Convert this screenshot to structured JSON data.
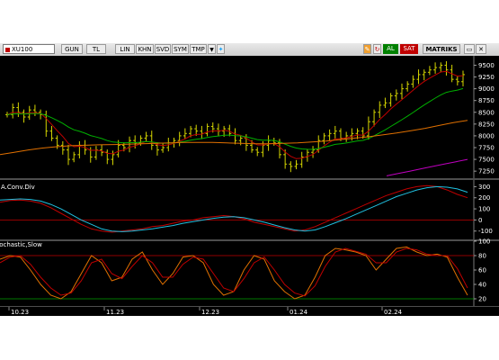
{
  "toolbar": {
    "symbol": "XU100",
    "buttons": [
      "GUN",
      "TL",
      "LIN",
      "KHN",
      "SVD",
      "SYM",
      "TMP"
    ],
    "al_label": "AL",
    "sat_label": "SAT",
    "matriks_label": "MATRIKS",
    "colors": {
      "al": "#008000",
      "sat": "#c00000"
    }
  },
  "chart_data": [
    {
      "type": "candlestick",
      "panel": "price",
      "title": "",
      "ylim": [
        7100,
        9700
      ],
      "yticks": [
        7250,
        7500,
        7750,
        8000,
        8250,
        8500,
        8750,
        9000,
        9250,
        9500
      ],
      "series": [
        {
          "name": "",
          "color": "#d4d400",
          "ohlc_close": [
            8450,
            8600,
            8500,
            8400,
            8550,
            8500,
            8450,
            8100,
            7950,
            7800,
            7700,
            7500,
            7600,
            7800,
            7700,
            7550,
            7700,
            7650,
            7500,
            7600,
            7800,
            7750,
            7900,
            7850,
            7950,
            8000,
            7800,
            7700,
            7750,
            7850,
            7900,
            8000,
            8050,
            8150,
            8100,
            8050,
            8200,
            8150,
            8100,
            8150,
            8050,
            7900,
            7950,
            7800,
            7700,
            7650,
            7800,
            7900,
            7850,
            7600,
            7400,
            7350,
            7400,
            7550,
            7650,
            7700,
            7900,
            8000,
            8050,
            8100,
            7950,
            8000,
            8050,
            8100,
            8000,
            8300,
            8500,
            8650,
            8700,
            8850,
            8900,
            9000,
            9100,
            9200,
            9300,
            9350,
            9400,
            9450,
            9500,
            9400,
            9200,
            9150,
            9300
          ]
        },
        {
          "name": "",
          "color": "#c00000",
          "values_ref": "price_ma_fast"
        },
        {
          "name": "",
          "color": "#00b000",
          "values_ref": "price_ma_mid"
        },
        {
          "name": "",
          "color": "#e07000",
          "values_ref": "price_ma_slow"
        },
        {
          "name": "",
          "color": "#c000c0",
          "values_ref": "price_ma_long"
        }
      ],
      "price_ma_slow": [
        7600,
        7650,
        7700,
        7740,
        7770,
        7790,
        7800,
        7810,
        7815,
        7820,
        7830,
        7840,
        7850,
        7860,
        7860,
        7860,
        7850,
        7840,
        7830,
        7830,
        7840,
        7850,
        7870,
        7890,
        7920,
        7950,
        7980,
        8020,
        8060,
        8110,
        8160,
        8220,
        8280,
        8330
      ],
      "price_ma_long": [
        7150,
        7200,
        7250,
        7300,
        7350,
        7400,
        7450,
        7500
      ]
    },
    {
      "type": "line",
      "panel": "macd",
      "title": "A.Conv.Div",
      "ylim": [
        -175,
        360
      ],
      "yticks": [
        -100,
        0,
        100,
        200,
        300
      ],
      "series": [
        {
          "name": "",
          "color": "#c00000",
          "values": [
            160,
            175,
            180,
            170,
            150,
            110,
            60,
            10,
            -40,
            -80,
            -100,
            -110,
            -100,
            -90,
            -80,
            -60,
            -50,
            -30,
            -10,
            0,
            20,
            30,
            40,
            30,
            10,
            -20,
            -40,
            -60,
            -80,
            -100,
            -90,
            -60,
            -20,
            20,
            60,
            100,
            140,
            180,
            220,
            250,
            280,
            300,
            310,
            300,
            270,
            230,
            200
          ]
        },
        {
          "name": "",
          "color": "#20c0e0",
          "values": [
            180,
            185,
            190,
            185,
            170,
            140,
            100,
            50,
            0,
            -40,
            -80,
            -100,
            -105,
            -100,
            -90,
            -80,
            -65,
            -50,
            -30,
            -15,
            0,
            15,
            25,
            30,
            20,
            0,
            -20,
            -45,
            -70,
            -90,
            -100,
            -90,
            -60,
            -25,
            10,
            50,
            90,
            130,
            170,
            210,
            240,
            270,
            290,
            300,
            295,
            280,
            250
          ]
        }
      ],
      "hline": 0
    },
    {
      "type": "line",
      "panel": "stochastic",
      "title": "Stochastic,Slow",
      "ylim": [
        10,
        100
      ],
      "yticks": [
        20,
        40,
        60,
        80,
        100
      ],
      "bands": [
        20,
        80
      ],
      "series": [
        {
          "name": "",
          "color": "#e07000",
          "values": [
            75,
            80,
            78,
            60,
            40,
            25,
            20,
            30,
            55,
            80,
            70,
            45,
            50,
            75,
            85,
            60,
            40,
            55,
            78,
            80,
            70,
            40,
            25,
            30,
            60,
            80,
            75,
            45,
            30,
            20,
            25,
            50,
            80,
            90,
            88,
            85,
            80,
            60,
            75,
            90,
            92,
            85,
            80,
            82,
            78,
            50,
            25
          ]
        },
        {
          "name": "",
          "color": "#c00000",
          "values": [
            70,
            78,
            80,
            68,
            50,
            35,
            25,
            28,
            45,
            70,
            75,
            55,
            48,
            65,
            80,
            70,
            50,
            50,
            68,
            78,
            75,
            55,
            35,
            30,
            48,
            70,
            78,
            60,
            40,
            28,
            24,
            38,
            65,
            85,
            90,
            86,
            82,
            70,
            70,
            85,
            90,
            88,
            82,
            80,
            80,
            62,
            35
          ]
        }
      ]
    }
  ],
  "x_axis": {
    "labels": [
      "10.23",
      "11.23",
      "12.23",
      "01.24",
      "02.24"
    ]
  }
}
